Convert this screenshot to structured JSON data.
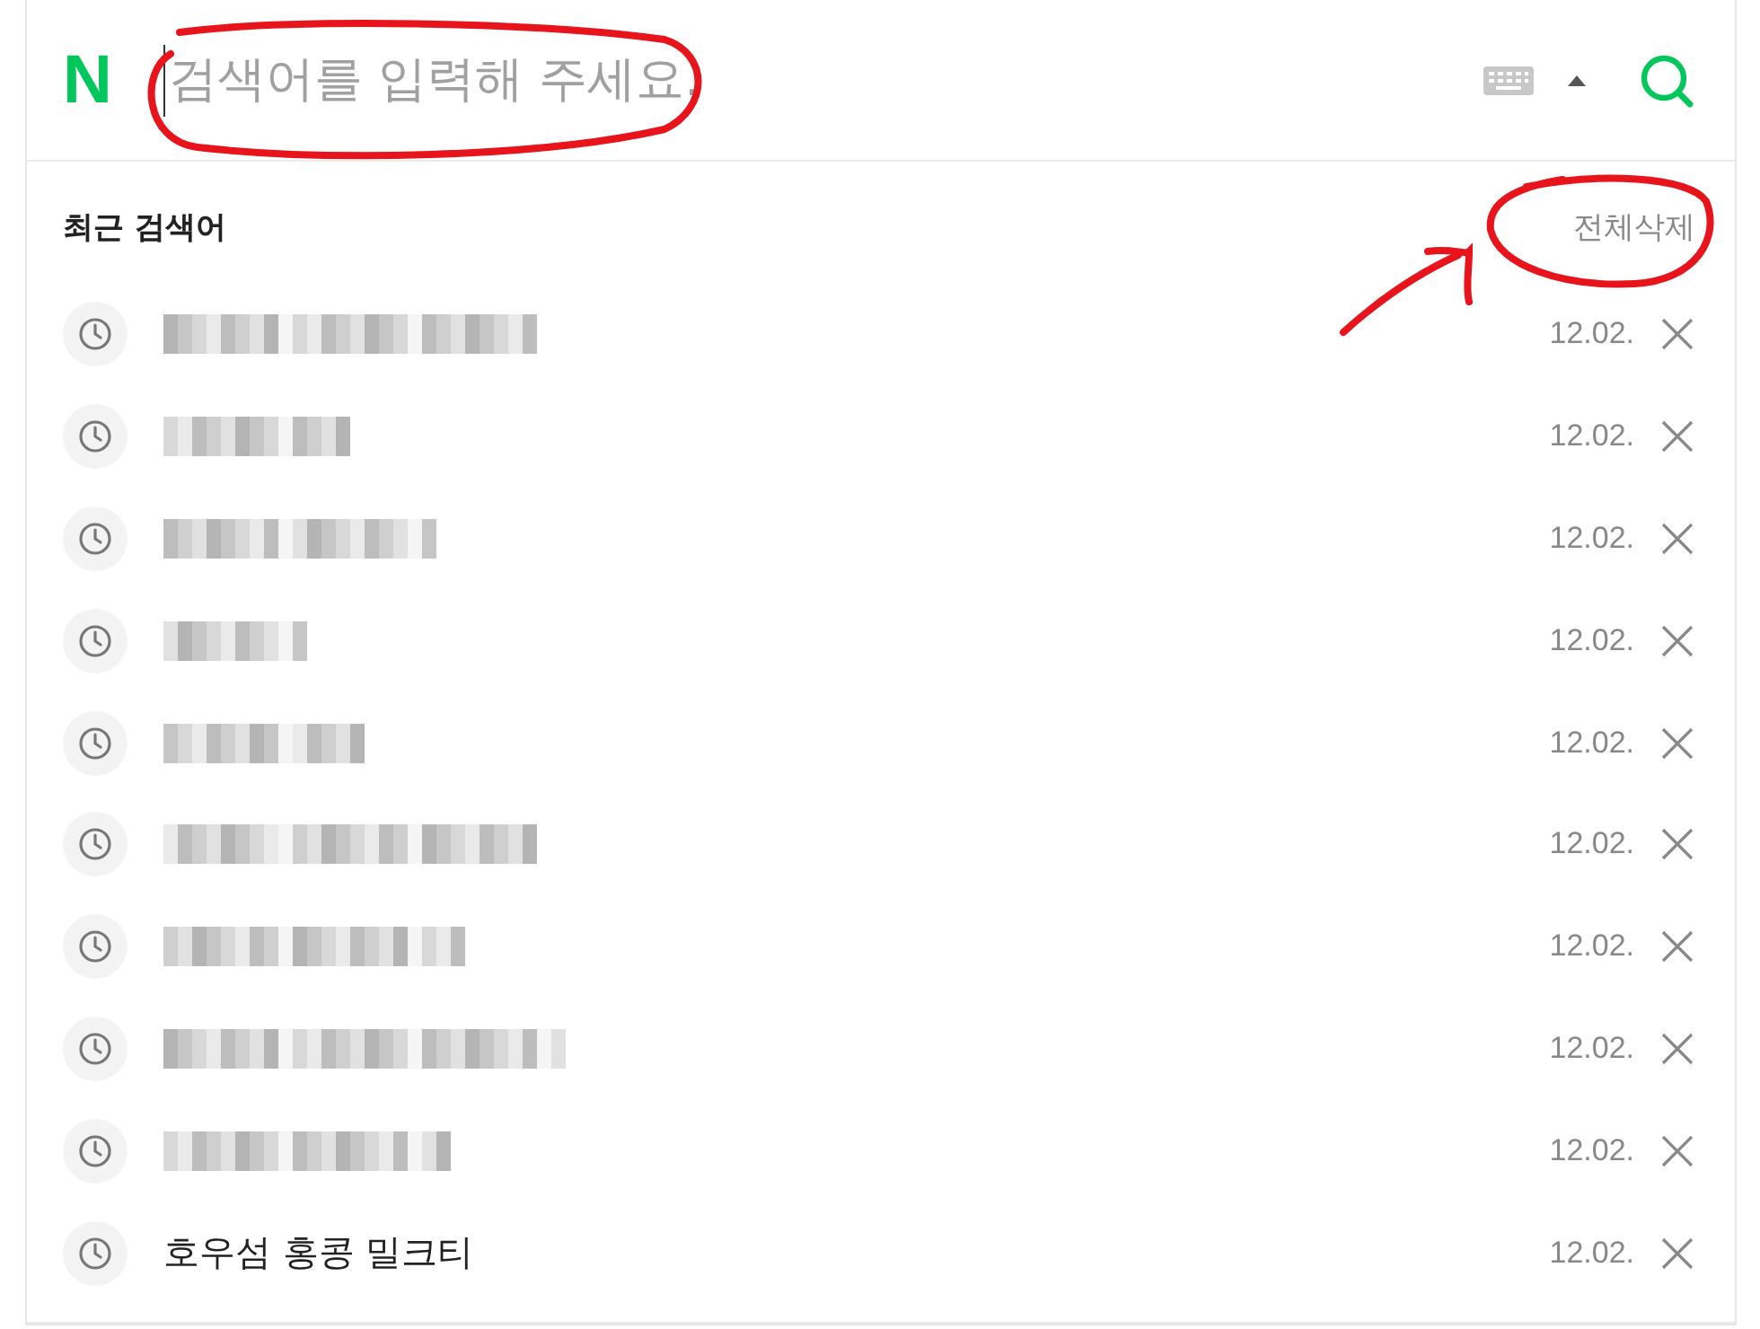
{
  "search": {
    "logo": "N",
    "placeholder": "검색어를 입력해 주세요."
  },
  "recent": {
    "title": "최근 검색어",
    "clear_all": "전체삭제",
    "items": [
      {
        "kind": "blurred",
        "date": "12.02."
      },
      {
        "kind": "blurred",
        "date": "12.02."
      },
      {
        "kind": "blurred",
        "date": "12.02."
      },
      {
        "kind": "blurred",
        "date": "12.02."
      },
      {
        "kind": "blurred",
        "date": "12.02."
      },
      {
        "kind": "blurred",
        "date": "12.02."
      },
      {
        "kind": "blurred",
        "date": "12.02."
      },
      {
        "kind": "blurred",
        "date": "12.02."
      },
      {
        "kind": "blurred",
        "date": "12.02."
      },
      {
        "kind": "text",
        "text": "호우섬 홍콩 밀크티",
        "date": "12.02."
      }
    ]
  }
}
